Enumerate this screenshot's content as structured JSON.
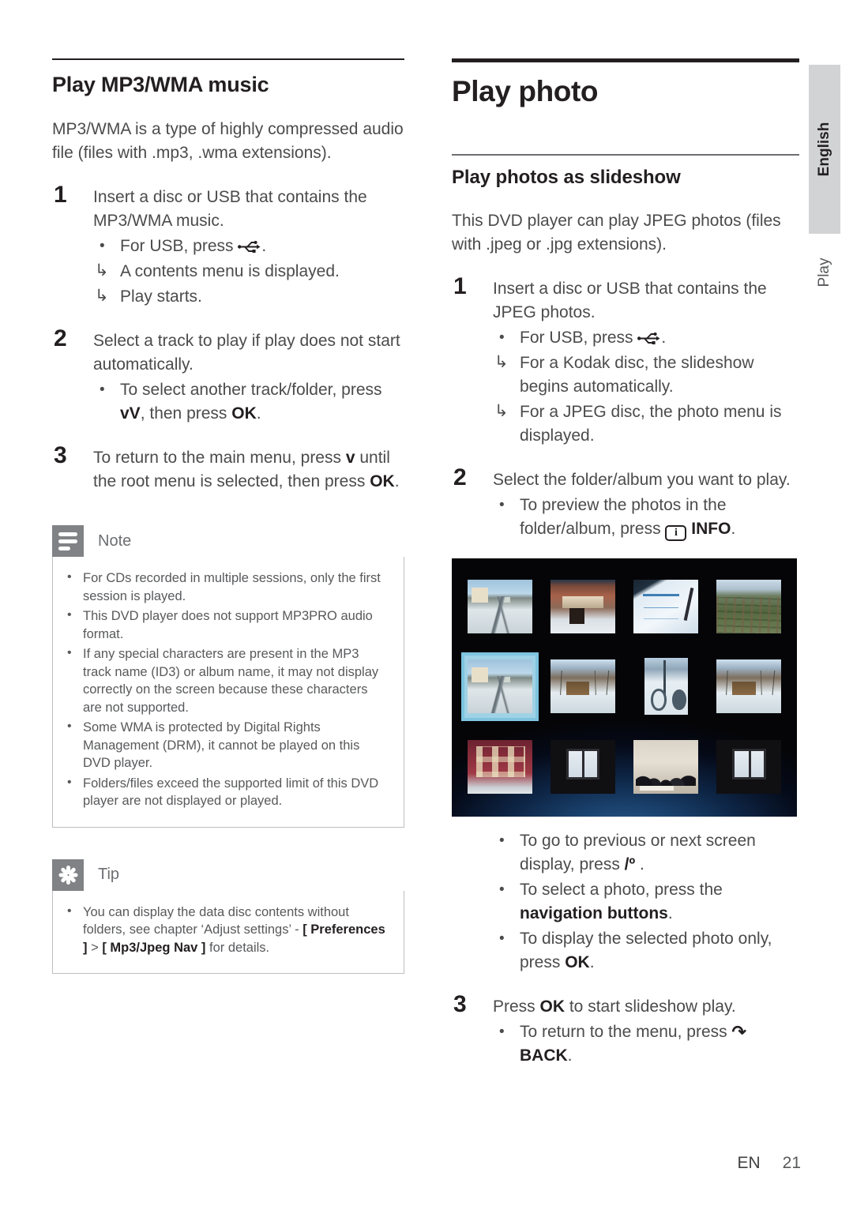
{
  "page": {
    "footer_lang": "EN",
    "footer_page": "21",
    "side_tab_language": "English",
    "side_tab_chapter": "Play"
  },
  "left_column": {
    "heading": "Play MP3/WMA music",
    "intro": "MP3/WMA is a type of highly compressed audio file (files with .mp3, .wma extensions).",
    "steps": [
      {
        "num": "1",
        "text": "Insert a disc or USB that contains the MP3/WMA music.",
        "subs": [
          {
            "kind": "bullet",
            "pre": "For USB, press ",
            "icon": "usb-icon",
            "post": "."
          },
          {
            "kind": "arrow",
            "text": "A contents menu is displayed."
          },
          {
            "kind": "arrow",
            "text": "Play starts."
          }
        ]
      },
      {
        "num": "2",
        "text": "Select a track to play if play does not start automatically.",
        "subs": [
          {
            "kind": "bullet",
            "pre": "To select another track/folder, press ",
            "glyph": "vV",
            "mid": ",  then press ",
            "bold": "OK",
            "post": "."
          }
        ]
      },
      {
        "num": "3",
        "pre": "To return to the main menu, press ",
        "glyph": "v",
        "mid": " until the root menu is selected, then press ",
        "bold": "OK",
        "post": "."
      }
    ],
    "note": {
      "label": "Note",
      "icon": "note-icon",
      "items": [
        "For CDs recorded in multiple sessions, only the first session is played.",
        "This DVD player does not support MP3PRO audio format.",
        "If any special characters are present in the MP3 track name (ID3) or album name, it may not display correctly on the screen because these characters are not supported.",
        "Some WMA is protected by Digital Rights Management (DRM), it cannot be played on this DVD player.",
        "Folders/files exceed the supported limit of this DVD player are not displayed or played."
      ]
    },
    "tip": {
      "label": "Tip",
      "icon": "tip-icon",
      "item_parts": {
        "p1": "You can display the data disc contents without folders, see chapter ‘Adjust settings’ - ",
        "b1": "[ Preferences ]",
        "p2": " > ",
        "b2": "[ Mp3/Jpeg Nav ]",
        "p3": " for details."
      }
    }
  },
  "right_column": {
    "heading": "Play photo",
    "subheading": "Play photos as slideshow",
    "intro": "This DVD player can play JPEG photos (files with .jpeg or .jpg extensions).",
    "steps": [
      {
        "num": "1",
        "text": "Insert a disc or USB that contains the JPEG photos.",
        "subs": [
          {
            "kind": "bullet",
            "pre": "For USB, press ",
            "icon": "usb-icon",
            "post": "."
          },
          {
            "kind": "arrow",
            "text": "For a Kodak disc, the slideshow begins automatically."
          },
          {
            "kind": "arrow",
            "text": "For a JPEG disc, the photo menu is displayed."
          }
        ]
      },
      {
        "num": "2",
        "text": "Select the folder/album you want to play.",
        "subs": [
          {
            "kind": "bullet",
            "pre": "To preview the photos in the folder/album, press ",
            "icon": "info-icon",
            "bold": "INFO",
            "post": "."
          }
        ]
      }
    ],
    "screenshot_bullets": [
      {
        "pre": "To go to previous or next screen display, press ",
        "glyph": "/º",
        "post": " ."
      },
      {
        "pre": "To select a photo, press the ",
        "bold": "navigation buttons",
        "post": "."
      },
      {
        "pre": "To display the selected photo only, press ",
        "bold": "OK",
        "post": "."
      }
    ],
    "step3": {
      "num": "3",
      "pre": "Press ",
      "bold": "OK",
      "post": " to start slideshow play.",
      "subs": [
        {
          "kind": "bullet",
          "pre": "To return to the menu, press ",
          "icon": "back-icon",
          "bold": "BACK",
          "post": "."
        }
      ]
    },
    "photo_grid": {
      "caption": "photo-thumbnail-browser",
      "columns": 4,
      "rows": 3,
      "selected_index": 4,
      "thumbnails": [
        {
          "name": "snowy-street",
          "art": "t-street",
          "orientation": "landscape"
        },
        {
          "name": "snow-covered-building",
          "art": "t-building",
          "orientation": "landscape"
        },
        {
          "name": "documents-and-pen",
          "art": "t-paper",
          "orientation": "landscape"
        },
        {
          "name": "aerial-town-view",
          "art": "t-aerial",
          "orientation": "landscape"
        },
        {
          "name": "snowy-street-selected",
          "art": "t-street",
          "orientation": "landscape"
        },
        {
          "name": "snow-cabin-trees",
          "art": "t-cabin",
          "orientation": "landscape"
        },
        {
          "name": "bicycle-in-snow",
          "art": "t-bike",
          "orientation": "portrait"
        },
        {
          "name": "snow-cabin-trees-2",
          "art": "t-cabin",
          "orientation": "landscape"
        },
        {
          "name": "red-brick-building",
          "art": "t-redbldg",
          "orientation": "landscape"
        },
        {
          "name": "dark-room-window",
          "art": "t-window",
          "orientation": "landscape"
        },
        {
          "name": "people-at-table",
          "art": "t-meeting",
          "orientation": "landscape"
        },
        {
          "name": "dark-room-window-2",
          "art": "t-window",
          "orientation": "landscape"
        }
      ],
      "colors": {
        "background": "#050508",
        "glow": "#2c5f93",
        "selection_border": "#7fc4de"
      }
    }
  }
}
